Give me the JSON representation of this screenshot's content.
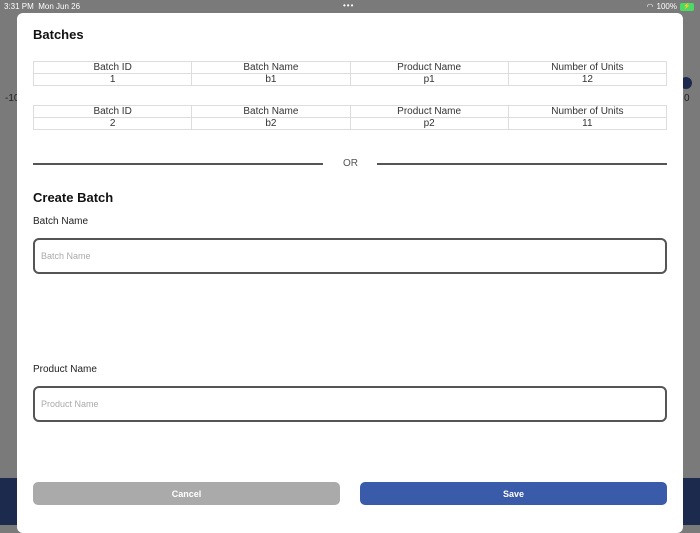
{
  "status": {
    "time": "3:31 PM",
    "date": "Mon Jun 26",
    "dots": "•••",
    "battery": "100%"
  },
  "background": {
    "left_text": "-10",
    "right_text": "0"
  },
  "modal": {
    "title": "Batches",
    "tables": [
      {
        "headers": [
          "Batch ID",
          "Batch Name",
          "Product Name",
          "Number of Units"
        ],
        "row": [
          "1",
          "b1",
          "p1",
          "12"
        ]
      },
      {
        "headers": [
          "Batch ID",
          "Batch Name",
          "Product Name",
          "Number of Units"
        ],
        "row": [
          "2",
          "b2",
          "p2",
          "11"
        ]
      }
    ],
    "or": "OR",
    "create_title": "Create Batch",
    "batch_name_label": "Batch Name",
    "batch_name_placeholder": "Batch Name",
    "batch_name_value": "",
    "product_name_label": "Product Name",
    "product_name_placeholder": "Product Name",
    "product_name_value": "",
    "cancel": "Cancel",
    "save": "Save"
  },
  "colors": {
    "save": "#3a5ba9",
    "cancel": "#aaaaaa",
    "backdrop": "#7a7a7a",
    "navy": "#1c2a4e"
  }
}
